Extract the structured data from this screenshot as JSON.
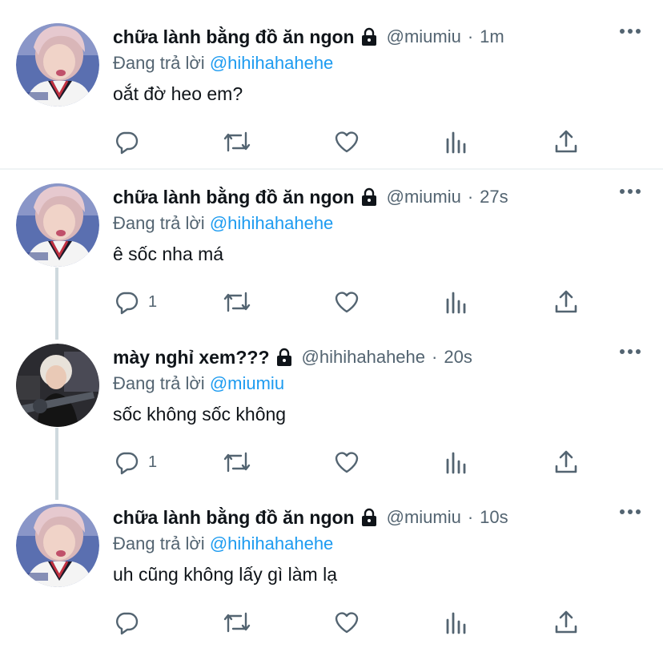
{
  "tweets": [
    {
      "display_name": "chữa lành bằng đồ ăn ngon",
      "handle": "@miumiu",
      "separator": "·",
      "time": "1m",
      "replying_prefix": "Đang trả lời",
      "replying_to": "@hihihahahehe",
      "text": "oắt đờ heo em?",
      "reply_count": "",
      "avatar": "pink-hair-avatar",
      "protected": true
    },
    {
      "display_name": "chữa lành bằng đồ ăn ngon",
      "handle": "@miumiu",
      "separator": "·",
      "time": "27s",
      "replying_prefix": "Đang trả lời",
      "replying_to": "@hihihahahehe",
      "text": "ê sốc nha má",
      "reply_count": "1",
      "avatar": "pink-hair-avatar",
      "protected": true
    },
    {
      "display_name": "mày nghỉ xem???",
      "handle": "@hihihahahehe",
      "separator": "·",
      "time": "20s",
      "replying_prefix": "Đang trả lời",
      "replying_to": "@miumiu",
      "text": "sốc không sốc không",
      "reply_count": "1",
      "avatar": "blonde-guitar-avatar",
      "protected": true
    },
    {
      "display_name": "chữa lành bằng đồ ăn ngon",
      "handle": "@miumiu",
      "separator": "·",
      "time": "10s",
      "replying_prefix": "Đang trả lời",
      "replying_to": "@hihihahahehe",
      "text": "uh cũng không lấy gì làm lạ",
      "reply_count": "",
      "avatar": "pink-hair-avatar",
      "protected": true
    }
  ],
  "colors": {
    "text": "#0f1419",
    "secondary": "#536471",
    "link": "#1d9bf0",
    "thread_line": "#cfd9de"
  },
  "icons": [
    "reply-icon",
    "retweet-icon",
    "like-icon",
    "analytics-icon",
    "share-icon",
    "lock-icon",
    "more-icon"
  ]
}
